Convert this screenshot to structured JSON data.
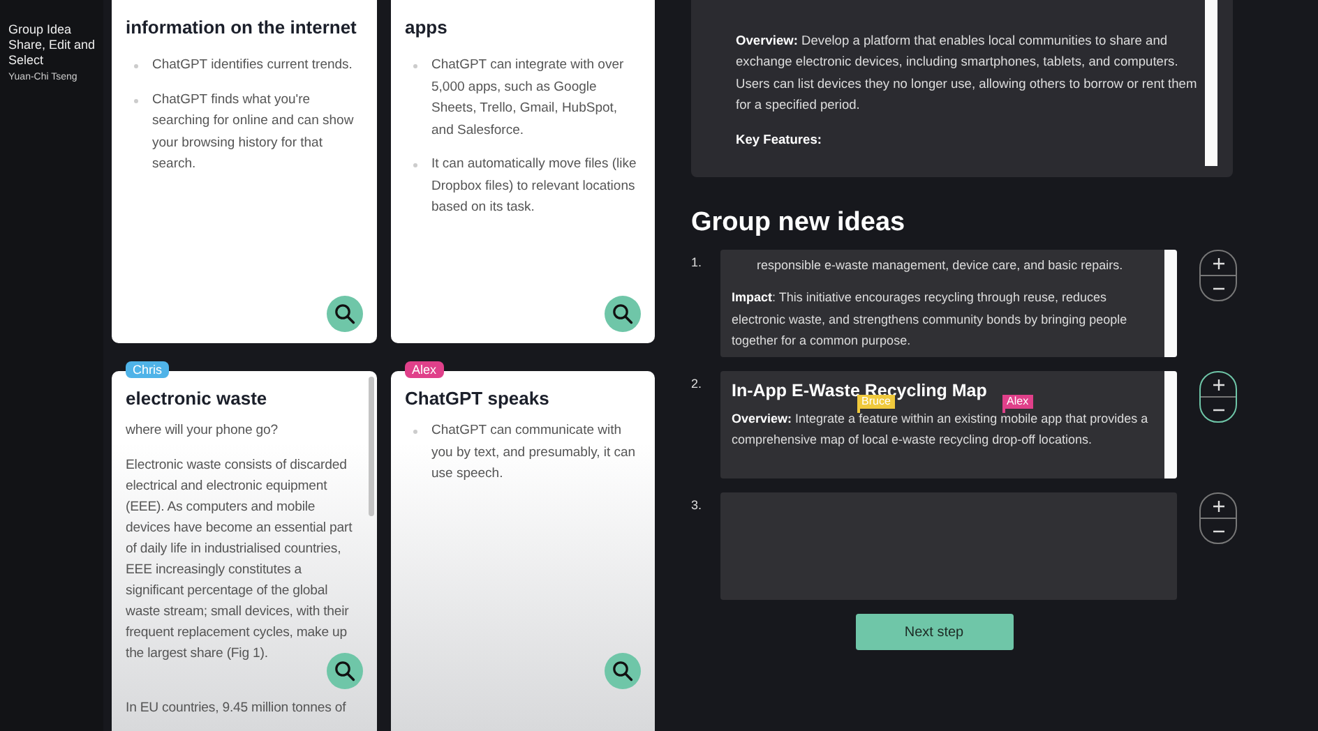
{
  "video_title": {
    "title": "Group Idea Share, Edit and Select",
    "author": "Yuan-Chi Tseng"
  },
  "cards": [
    {
      "title": "information on the internet",
      "kind": "bullets",
      "scrollbar": false,
      "items": [
        "ChatGPT identifies current trends.",
        "ChatGPT finds what you're searching for online and can show your browsing history for that search."
      ]
    },
    {
      "title": "apps",
      "kind": "bullets",
      "scrollbar": false,
      "items": [
        "ChatGPT can integrate with over 5,000 apps, such as Google Sheets, Trello, Gmail, HubSpot, and Salesforce.",
        "It can automatically move files (like Dropbox files) to relevant locations based on its task."
      ]
    },
    {
      "title": "electronic waste",
      "kind": "paragraphs",
      "scrollbar": true,
      "tag": {
        "name": "Chris",
        "color": "#4fb3e8"
      },
      "items": [
        "where will your phone go?",
        "Electronic waste consists of discarded electrical and electronic equipment (EEE). As computers and mobile devices have become an essential part of daily life in industrialised countries, EEE increasingly constitutes a significant percentage of the global waste stream; small devices, with their frequent replacement cycles, make up the largest share (Fig 1).",
        "In EU countries, 9.45 million tonnes of"
      ]
    },
    {
      "title": "ChatGPT speaks",
      "kind": "bullets",
      "scrollbar": false,
      "tag": {
        "name": "Alex",
        "color": "#e0408a"
      },
      "items": [
        "ChatGPT can communicate with you by text, and presumably, it can use speech."
      ]
    }
  ],
  "selected_idea": {
    "paragraphs": [
      {
        "kind": "paragraph",
        "text": "**Overview:** Develop a platform that enables local communities to share and exchange electronic devices, including smartphones, tablets, and computers. Users can list devices they no longer use, allowing others to borrow or rent them for a specified period."
      },
      {
        "kind": "label",
        "text": "Key Features:"
      }
    ]
  },
  "group": {
    "heading": "Group new ideas",
    "ideas": [
      {
        "number": "1.",
        "highlighted": false,
        "paragraphs": [
          {
            "kind": "list_item",
            "text": "responsible e-waste management, device care, and basic repairs."
          },
          {
            "kind": "paragraph",
            "text": "**Impact**: This initiative encourages recycling through reuse, reduces electronic waste, and strengthens community bonds by bringing people together for a common purpose."
          }
        ]
      },
      {
        "number": "2.",
        "highlighted": true,
        "title": "In-App E-Waste Recycling Map",
        "paragraphs": [
          {
            "kind": "paragraph",
            "text": "**Overview:** Integrate a feature within an existing mobile app that provides a comprehensive map of local e-waste recycling drop-off locations."
          }
        ],
        "cursors": [
          {
            "name": "Bruce",
            "color": "#f0c93c"
          },
          {
            "name": "Alex",
            "color": "#e0408a"
          }
        ]
      },
      {
        "number": "3.",
        "highlighted": false
      }
    ],
    "next_button": "Next step"
  }
}
